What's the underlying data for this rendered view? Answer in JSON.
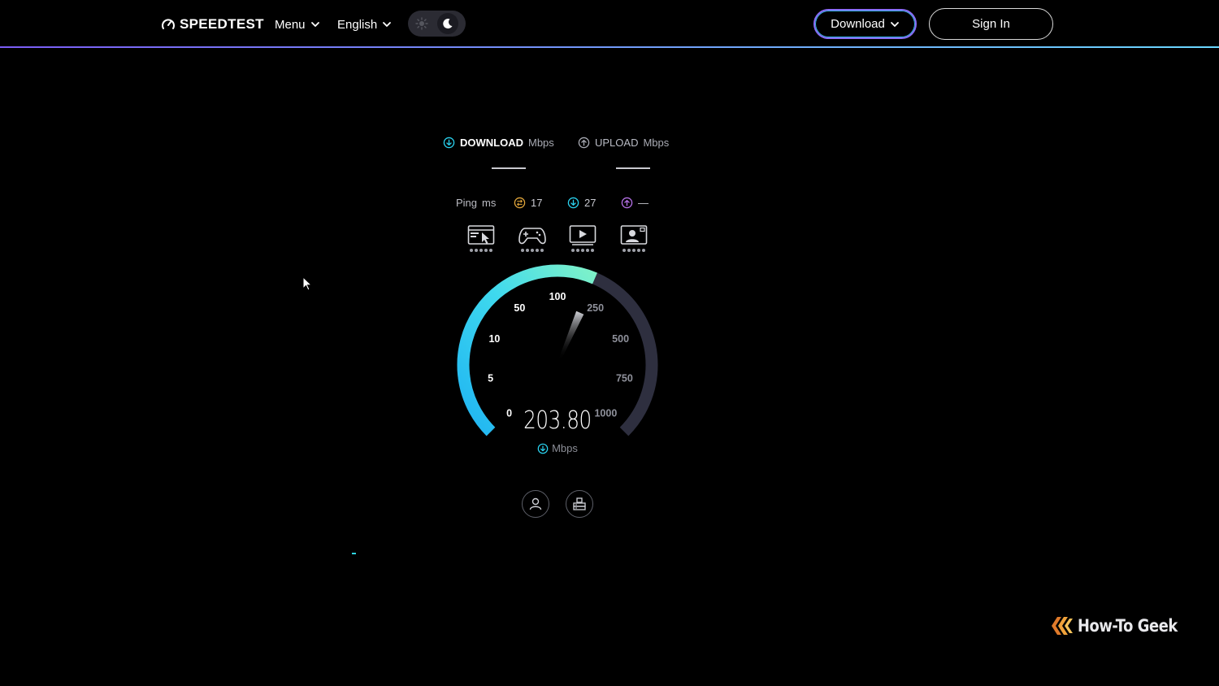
{
  "header": {
    "logo_text": "SPEEDTEST",
    "menu_label": "Menu",
    "language_label": "English",
    "download_label": "Download",
    "signin_label": "Sign In"
  },
  "metrics": {
    "download_label": "DOWNLOAD",
    "download_unit": "Mbps",
    "upload_label": "UPLOAD",
    "upload_unit": "Mbps"
  },
  "ping": {
    "label": "Ping",
    "unit": "ms",
    "idle": "17",
    "download": "27",
    "upload": "—"
  },
  "gauge": {
    "value": "203.80",
    "unit": "Mbps",
    "ticks": [
      "0",
      "5",
      "10",
      "50",
      "100",
      "250",
      "500",
      "750",
      "1000"
    ],
    "reading_mbps": 203.8
  },
  "colors": {
    "accent_cyan": "#2ad3f0",
    "accent_green": "#6ff0c3",
    "accent_purple": "#8a6cf7",
    "ping_idle": "#e2a63b",
    "ping_upload": "#b671e8",
    "gauge_track": "#2e2f3f"
  },
  "watermark": {
    "text": "How-To Geek"
  }
}
